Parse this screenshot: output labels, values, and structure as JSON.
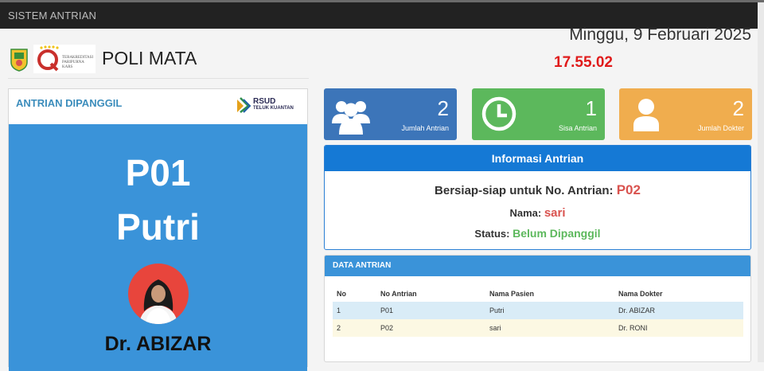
{
  "navbar": {
    "brand": "SISTEM ANTRIAN"
  },
  "header": {
    "page_title": "POLI MATA",
    "date": "Minggu, 9 Februari 2025",
    "time": "17.55.02",
    "kars_logo_text": [
      "TERAKREDITASI",
      "PARIPURNA",
      "KARS"
    ]
  },
  "left_panel": {
    "title": "ANTRIAN DIPANGGIL",
    "hospital_logo_line1": "RSUD",
    "hospital_logo_line2": "TELUK KUANTAN",
    "queue_code": "P01",
    "patient_name": "Putri",
    "doctor": "Dr. ABIZAR"
  },
  "stats": [
    {
      "value": "2",
      "label": "Jumlah Antrian",
      "icon": "users-icon",
      "color": "#3c75b9"
    },
    {
      "value": "1",
      "label": "Sisa Antrian",
      "icon": "clock-icon",
      "color": "#5cb85c"
    },
    {
      "value": "2",
      "label": "Jumlah Dokter",
      "icon": "user-icon",
      "color": "#f0ad4e"
    }
  ],
  "info": {
    "title": "Informasi Antrian",
    "prepare_label": "Bersiap-siap untuk No. Antrian:",
    "prepare_value": "P02",
    "name_label": "Nama:",
    "name_value": "sari",
    "status_label": "Status:",
    "status_value": "Belum Dipanggil"
  },
  "data_table": {
    "title": "DATA ANTRIAN",
    "columns": [
      "No",
      "No Antrian",
      "Nama Pasien",
      "Nama Dokter"
    ],
    "rows": [
      [
        "1",
        "P01",
        "Putri",
        "Dr. ABIZAR"
      ],
      [
        "2",
        "P02",
        "sari",
        "Dr. RONI"
      ]
    ]
  },
  "colors": {
    "primary": "#3a93d9",
    "success": "#5cb85c",
    "warning": "#f0ad4e",
    "danger": "#d9534f",
    "clock": "#e01b1b"
  }
}
